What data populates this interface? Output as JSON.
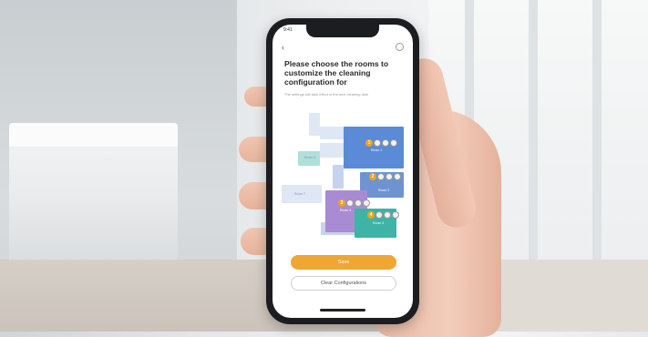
{
  "status": {
    "time": "9:41"
  },
  "header": {
    "title": "Please choose the rooms to customize the cleaning configuration for",
    "subtitle": "The settings will take effect in the next cleaning task"
  },
  "map": {
    "rooms": [
      {
        "label": "Room 1",
        "order": "1",
        "color": "#5b8ad6"
      },
      {
        "label": "Room 2",
        "order": "2",
        "color": "#6f93d1"
      },
      {
        "label": "Room 3",
        "order": "3",
        "color": "#a98bd3"
      },
      {
        "label": "Room 4",
        "order": "4",
        "color": "#3fb3a5"
      },
      {
        "label": "Room 5",
        "order": "",
        "color": "#aee0d9"
      },
      {
        "label": "Room 6",
        "order": "",
        "color": "#c7d3ee"
      },
      {
        "label": "Room 7",
        "order": "",
        "color": "#dfe6f4"
      }
    ]
  },
  "actions": {
    "save_label": "Save",
    "clear_label": "Clear Configurations"
  },
  "colors": {
    "accent": "#efa632"
  }
}
